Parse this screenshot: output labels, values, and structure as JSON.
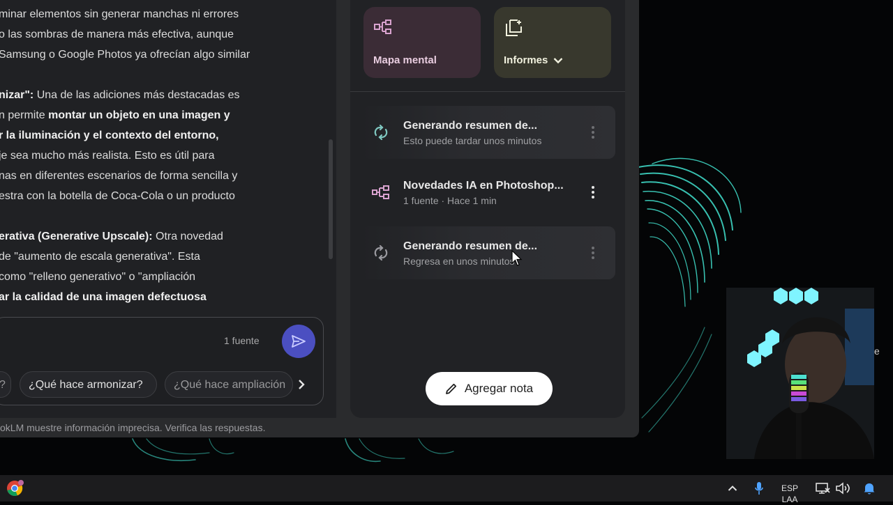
{
  "colors": {
    "accent_send": "#4b4fc1",
    "mind_map_tile": "#3b2c36",
    "reports_tile": "#38382d",
    "mind_map_icon": "#d9a3cf",
    "background_swirl": "#3fd6c4"
  },
  "chat": {
    "lines": [
      "minar elementos sin generar manchas ni errores",
      "o las sombras de manera más efectiva, aunque",
      "Samsung o Google Photos ya ofrecían algo similar"
    ],
    "p2": {
      "l1_bold": "nizar\":",
      "l1_rest": " Una de las adiciones más destacadas es",
      "l2_rest": "n permite ",
      "l2_bold": "montar un objeto en una imagen y",
      "l3_bold": "r la iluminación y el contexto del entorno,",
      "l4": "je sea mucho más realista. Esto es útil para",
      "l5": "nas en diferentes escenarios de forma sencilla y",
      "l6": "estra con la botella de Coca-Cola o un producto"
    },
    "p3": {
      "l1_bold": "erativa (Generative Upscale):",
      "l1_rest": " Otra novedad",
      "l2": " de \"aumento de escala generativa\". Esta",
      "l3": "como \"relleno generativo\" o \"ampliación",
      "l4_bold": "ar la calidad de una imagen defectuosa"
    },
    "source_count": "1 fuente",
    "send_icon": "send-icon",
    "chips": [
      "?",
      "¿Qué hace armonizar?",
      "¿Qué hace ampliación"
    ],
    "footer": "okLM muestre información imprecisa. Verifica las respuestas."
  },
  "studio": {
    "tiles": {
      "mind_map": {
        "label": "Mapa mental",
        "icon": "mind-map-icon"
      },
      "reports": {
        "label": "Informes",
        "icon": "reports-icon"
      }
    },
    "notes": [
      {
        "title": "Generando resumen de...",
        "subtitle": "Esto puede tardar unos minutos",
        "icon": "sync-icon"
      },
      {
        "title": "Novedades IA en Photoshop...",
        "subtitle": "1 fuente · Hace 1 min",
        "icon": "mind-map-icon"
      },
      {
        "title": "Generando resumen de...",
        "subtitle": "Regresa en unos minutos",
        "icon": "sync-icon"
      }
    ],
    "add_note": "Agregar nota"
  },
  "webcam": {
    "edge_text": "e"
  },
  "taskbar": {
    "lang_top": "ESP",
    "lang_bottom": "LAA"
  }
}
